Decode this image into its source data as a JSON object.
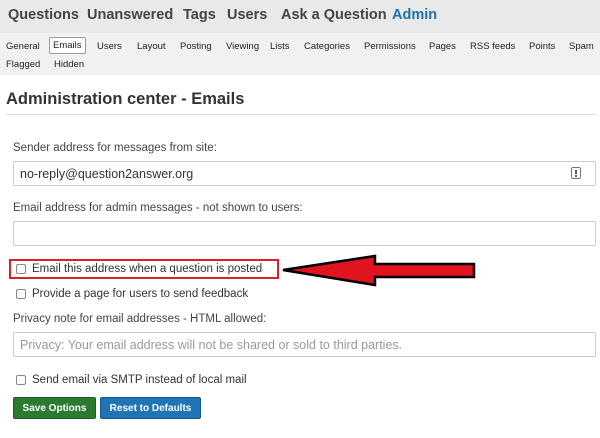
{
  "topnav": {
    "items": [
      {
        "label": "Questions",
        "active": false
      },
      {
        "label": "Unanswered",
        "active": false
      },
      {
        "label": "Tags",
        "active": false
      },
      {
        "label": "Users",
        "active": false
      },
      {
        "label": "Ask a Question",
        "active": false
      },
      {
        "label": "Admin",
        "active": true
      }
    ]
  },
  "subnav": {
    "row1": [
      "General",
      "Emails",
      "Users",
      "Layout",
      "Posting",
      "Viewing",
      "Lists",
      "Categories",
      "Permissions",
      "Pages",
      "RSS feeds",
      "Points",
      "Spam"
    ],
    "row2": [
      "Flagged",
      "Hidden"
    ],
    "selected": "Emails"
  },
  "page": {
    "title": "Administration center - Emails"
  },
  "form": {
    "sender_label": "Sender address for messages from site:",
    "sender_value": "no-reply@question2answer.org",
    "admin_email_label": "Email address for admin messages - not shown to users:",
    "admin_email_value": "",
    "notify_on_question_label": "Email this address when a question is posted",
    "feedback_page_label": "Provide a page for users to send feedback",
    "privacy_label": "Privacy note for email addresses - HTML allowed:",
    "privacy_placeholder": "Privacy: Your email address will not be shared or sold to third parties.",
    "smtp_label": "Send email via SMTP instead of local mail"
  },
  "buttons": {
    "save_label": "Save Options",
    "reset_label": "Reset to Defaults"
  },
  "colors": {
    "accent": "#1f6fab",
    "highlight": "#d9232b",
    "save": "#2c7a30",
    "reset": "#1f74b5"
  }
}
